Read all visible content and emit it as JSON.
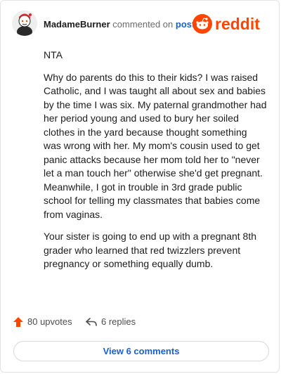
{
  "header": {
    "username": "MadameBurner",
    "action_text": "commented on",
    "target_link": "post",
    "logo_text": "reddit",
    "brand_color": "#ff4500",
    "link_color": "#1a5fd1"
  },
  "comment": {
    "paragraphs": [
      "NTA",
      "Why do parents do this to their kids? I was raised Catholic, and I was taught all about sex and babies by the time I was six. My paternal grandmother had her period young and used to bury her soiled clothes in the yard because thought something was wrong with her. My mom's cousin used to get panic attacks because her mom told her to \"never let a man touch her\" otherwise she'd get pregnant. Meanwhile, I got in trouble in 3rd grade public school for telling my classmates that babies come from vaginas.",
      "Your sister is going to end up with a pregnant 8th grader who learned that red twizzlers prevent pregnancy or something equally dumb."
    ]
  },
  "actions": {
    "upvotes_label": "80 upvotes",
    "replies_label": "6 replies",
    "upvote_icon": "upvote-arrow-icon",
    "reply_icon": "reply-arrow-icon"
  },
  "footer": {
    "view_comments_label": "View 6 comments"
  }
}
